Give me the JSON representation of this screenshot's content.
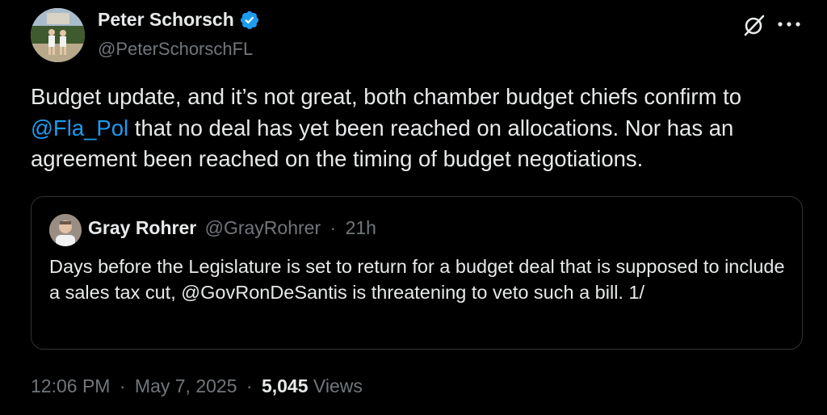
{
  "author": {
    "name": "Peter Schorsch",
    "handle": "@PeterSchorschFL",
    "verified": true,
    "avatar_icon": "profile-photo"
  },
  "toolbar": {
    "grok_icon": "grok-icon",
    "more_icon": "more-options-icon"
  },
  "tweet": {
    "text_part1": "Budget update, and it’s not great, both chamber budget chiefs confirm to ",
    "mention": "@Fla_Pol",
    "text_part2": " that no deal has yet been reached on allocations. Nor has an agreement been reached on the timing of budget negotiations."
  },
  "quote": {
    "name": "Gray Rohrer",
    "handle": "@GrayRohrer",
    "separator": "·",
    "time": "21h",
    "text": "Days before the Legislature is set to return for a budget deal that is supposed to include a sales tax cut, @GovRonDeSantis is threatening to veto such a bill. 1/"
  },
  "meta": {
    "time": "12:06 PM",
    "separator": "·",
    "date": "May 7, 2025",
    "views_count": "5,045",
    "views_label": "Views"
  },
  "colors": {
    "background": "#000000",
    "text": "#e7e9ea",
    "secondary": "#71767b",
    "accent": "#1d9bf0",
    "border": "#2f3336"
  }
}
